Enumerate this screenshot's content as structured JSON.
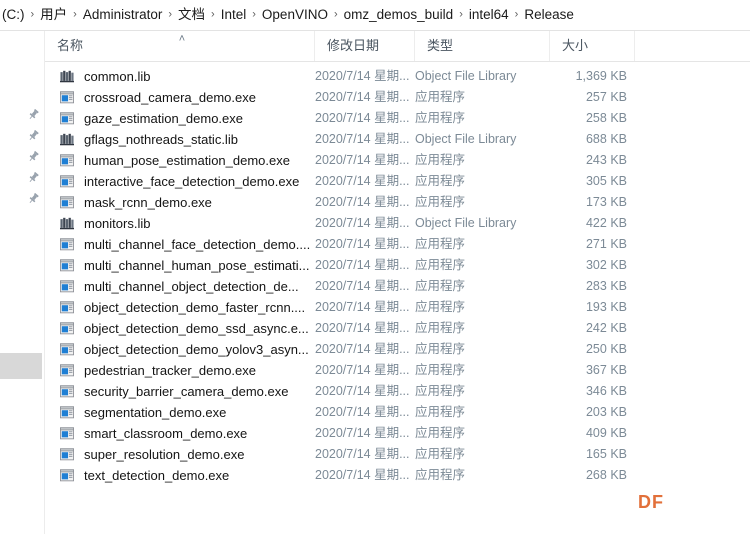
{
  "window": {
    "app": "File Explorer",
    "breadcrumb": {
      "separator": "›",
      "items": [
        {
          "label": "(C:)"
        },
        {
          "label": "用户"
        },
        {
          "label": "Administrator"
        },
        {
          "label": "文档"
        },
        {
          "label": "Intel"
        },
        {
          "label": "OpenVINO"
        },
        {
          "label": "omz_demos_build"
        },
        {
          "label": "intel64"
        },
        {
          "label": "Release"
        }
      ]
    }
  },
  "columns": {
    "name": "名称",
    "date": "修改日期",
    "type": "类型",
    "size": "大小",
    "sort_indicator": "˄",
    "sort_column": "名称",
    "sort_direction": "ascending"
  },
  "sidebar": {
    "pins": [
      {
        "name": "pin-icon-1"
      },
      {
        "name": "pin-icon-2"
      },
      {
        "name": "pin-icon-3"
      },
      {
        "name": "pin-icon-4"
      },
      {
        "name": "pin-icon-5"
      }
    ]
  },
  "files": [
    {
      "name": "common.lib",
      "date": "2020/7/14 星期...",
      "type": "Object File Library",
      "size": "1,369 KB",
      "icon": "library-file-icon"
    },
    {
      "name": "crossroad_camera_demo.exe",
      "date": "2020/7/14 星期...",
      "type": "应用程序",
      "size": "257 KB",
      "icon": "application-file-icon"
    },
    {
      "name": "gaze_estimation_demo.exe",
      "date": "2020/7/14 星期...",
      "type": "应用程序",
      "size": "258 KB",
      "icon": "application-file-icon"
    },
    {
      "name": "gflags_nothreads_static.lib",
      "date": "2020/7/14 星期...",
      "type": "Object File Library",
      "size": "688 KB",
      "icon": "library-file-icon"
    },
    {
      "name": "human_pose_estimation_demo.exe",
      "date": "2020/7/14 星期...",
      "type": "应用程序",
      "size": "243 KB",
      "icon": "application-file-icon"
    },
    {
      "name": "interactive_face_detection_demo.exe",
      "date": "2020/7/14 星期...",
      "type": "应用程序",
      "size": "305 KB",
      "icon": "application-file-icon"
    },
    {
      "name": "mask_rcnn_demo.exe",
      "date": "2020/7/14 星期...",
      "type": "应用程序",
      "size": "173 KB",
      "icon": "application-file-icon"
    },
    {
      "name": "monitors.lib",
      "date": "2020/7/14 星期...",
      "type": "Object File Library",
      "size": "422 KB",
      "icon": "library-file-icon"
    },
    {
      "name": "multi_channel_face_detection_demo....",
      "date": "2020/7/14 星期...",
      "type": "应用程序",
      "size": "271 KB",
      "icon": "application-file-icon"
    },
    {
      "name": "multi_channel_human_pose_estimati...",
      "date": "2020/7/14 星期...",
      "type": "应用程序",
      "size": "302 KB",
      "icon": "application-file-icon"
    },
    {
      "name": "multi_channel_object_detection_de...",
      "date": "2020/7/14 星期...",
      "type": "应用程序",
      "size": "283 KB",
      "icon": "application-file-icon"
    },
    {
      "name": "object_detection_demo_faster_rcnn....",
      "date": "2020/7/14 星期...",
      "type": "应用程序",
      "size": "193 KB",
      "icon": "application-file-icon"
    },
    {
      "name": "object_detection_demo_ssd_async.e...",
      "date": "2020/7/14 星期...",
      "type": "应用程序",
      "size": "242 KB",
      "icon": "application-file-icon"
    },
    {
      "name": "object_detection_demo_yolov3_asyn...",
      "date": "2020/7/14 星期...",
      "type": "应用程序",
      "size": "250 KB",
      "icon": "application-file-icon"
    },
    {
      "name": "pedestrian_tracker_demo.exe",
      "date": "2020/7/14 星期...",
      "type": "应用程序",
      "size": "367 KB",
      "icon": "application-file-icon"
    },
    {
      "name": "security_barrier_camera_demo.exe",
      "date": "2020/7/14 星期...",
      "type": "应用程序",
      "size": "346 KB",
      "icon": "application-file-icon"
    },
    {
      "name": "segmentation_demo.exe",
      "date": "2020/7/14 星期...",
      "type": "应用程序",
      "size": "203 KB",
      "icon": "application-file-icon"
    },
    {
      "name": "smart_classroom_demo.exe",
      "date": "2020/7/14 星期...",
      "type": "应用程序",
      "size": "409 KB",
      "icon": "application-file-icon"
    },
    {
      "name": "super_resolution_demo.exe",
      "date": "2020/7/14 星期...",
      "type": "应用程序",
      "size": "165 KB",
      "icon": "application-file-icon"
    },
    {
      "name": "text_detection_demo.exe",
      "date": "2020/7/14 星期...",
      "type": "应用程序",
      "size": "268 KB",
      "icon": "application-file-icon"
    }
  ],
  "watermark": {
    "text": "DF",
    "color": "#e2703a"
  }
}
